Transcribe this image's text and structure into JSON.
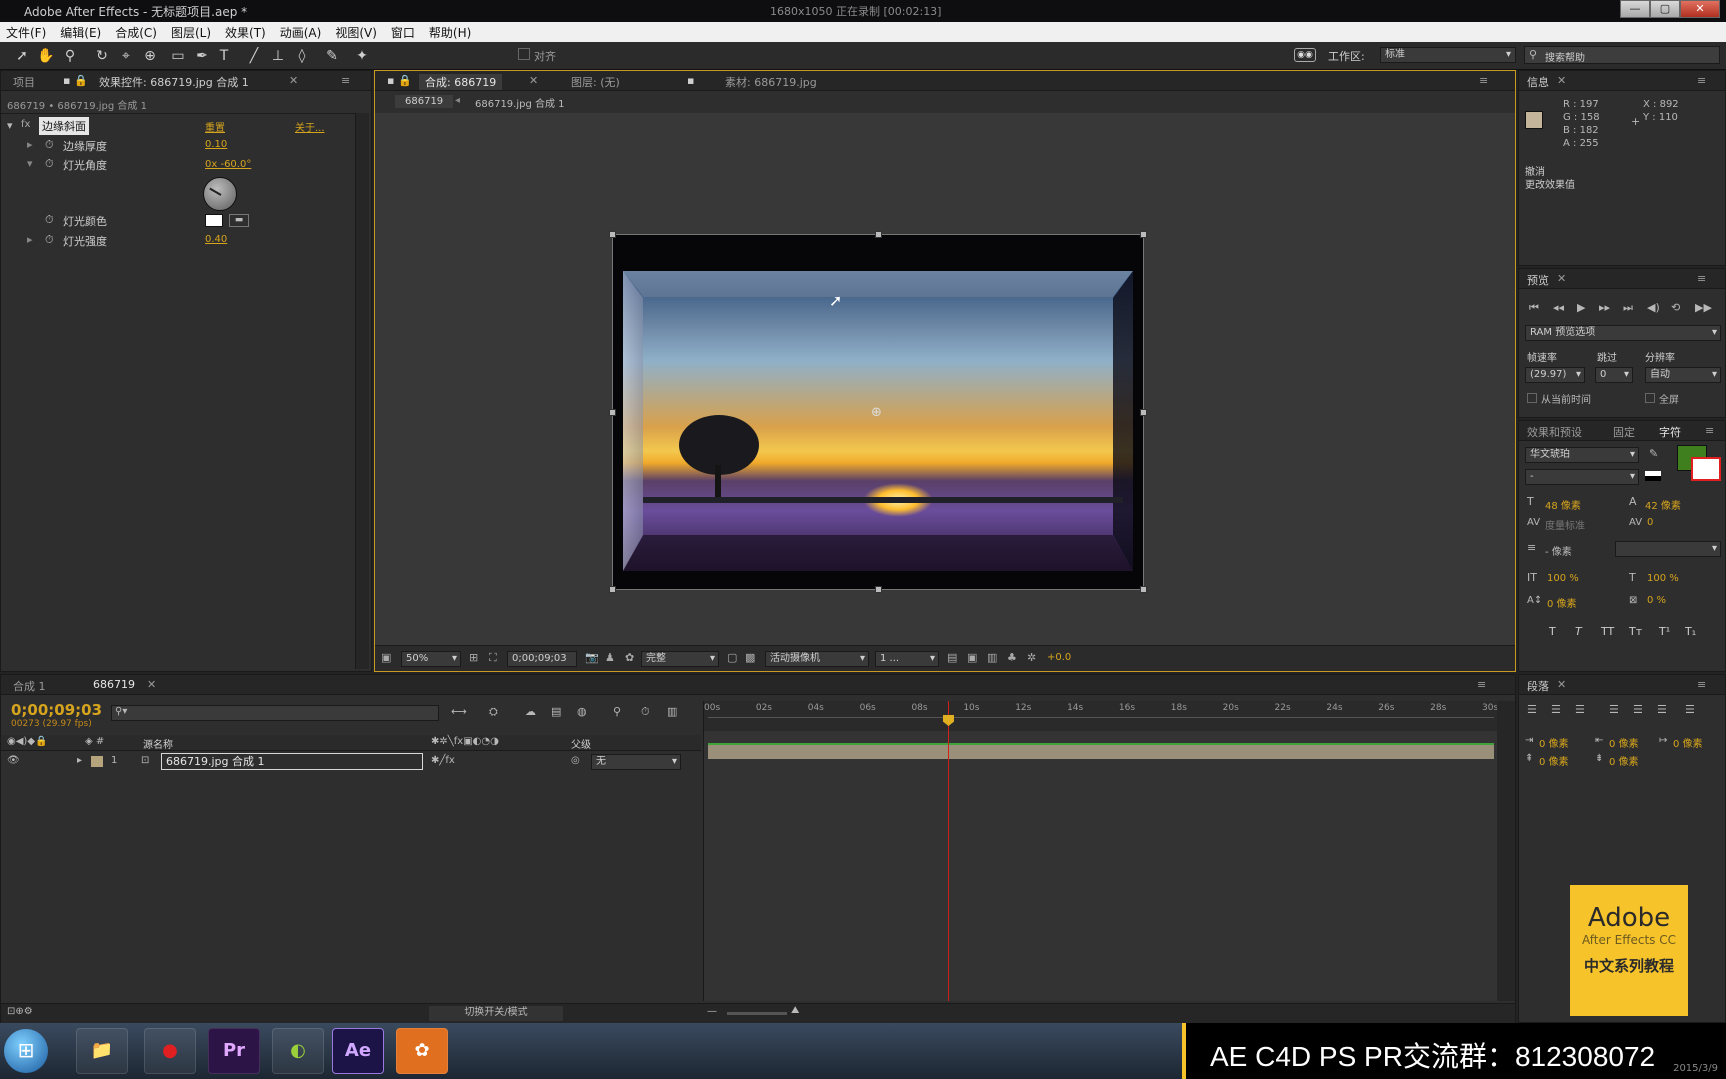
{
  "window": {
    "title": "Adobe After Effects - 无标题项目.aep *",
    "recording_info": "1680x1050  正在录制 [00:02:13]",
    "min_label": "—",
    "max_label": "▢",
    "close_label": "✕"
  },
  "menu": [
    "文件(F)",
    "编辑(E)",
    "合成(C)",
    "图层(L)",
    "效果(T)",
    "动画(A)",
    "视图(V)",
    "窗口",
    "帮助(H)"
  ],
  "toolbar": {
    "align_label": "对齐",
    "workspace_label": "工作区:",
    "workspace_value": "标准",
    "search_placeholder": "搜索帮助"
  },
  "effects_panel": {
    "tab_project": "项目",
    "tab_effects": "效果控件: 686719.jpg 合成 1",
    "breadcrumb": "686719 • 686719.jpg 合成 1",
    "effect_name": "边缘斜面",
    "reset": "重置",
    "about": "关于...",
    "params": [
      {
        "name": "边缘厚度",
        "value": "0.10"
      },
      {
        "name": "灯光角度",
        "value": "0x -60.0°"
      },
      {
        "name": "灯光颜色",
        "value": ""
      },
      {
        "name": "灯光强度",
        "value": "0.40"
      }
    ]
  },
  "comp_panel": {
    "tab_comp": "合成: 686719",
    "tab_layer": "图层: (无)",
    "tab_footage": "素材: 686719.jpg",
    "crumb1": "686719",
    "crumb2": "686719.jpg 合成 1",
    "zoom": "50%",
    "timecode": "0;00;09;03",
    "quality": "完整",
    "camera": "活动摄像机",
    "views": "1 ...",
    "exposure": "+0.0"
  },
  "info_panel": {
    "title": "信息",
    "r": "R : 197",
    "g": "G : 158",
    "b": "B : 182",
    "a": "A : 255",
    "x": "X : 892",
    "y": "Y : 110",
    "undo_line1": "撤消",
    "undo_line2": "更改效果值"
  },
  "preview_panel": {
    "title": "预览",
    "ram_options": "RAM 预览选项",
    "frame_rate_label": "帧速率",
    "skip_label": "跳过",
    "resolution_label": "分辨率",
    "frame_rate": "(29.97)",
    "skip": "0",
    "resolution": "自动",
    "from_current": "从当前时间",
    "fullscreen": "全屏"
  },
  "char_panel": {
    "tab_effects": "效果和预设",
    "tab_align": "固定",
    "tab_char": "字符",
    "font": "华文琥珀",
    "style": "-",
    "size": "48 像素",
    "leading": "42 像素",
    "tracking_label": "度量标准",
    "tracking": "0",
    "stroke": "- 像素",
    "vscale": "100 %",
    "hscale": "100 %",
    "baseline": "0 像素",
    "tsume": "0 %",
    "fill_color": "#3f7f1e"
  },
  "timeline": {
    "tab_render": "合成 1",
    "tab_comp": "686719",
    "timecode": "0;00;09;03",
    "fps": "00273 (29.97 fps)",
    "col_source": "源名称",
    "col_parent": "父级",
    "layer_index": "1",
    "layer_name": "686719.jpg 合成 1",
    "parent_value": "无",
    "toggle_label": "切换开关/模式",
    "ruler": [
      "00s",
      "02s",
      "04s",
      "06s",
      "08s",
      "10s",
      "12s",
      "14s",
      "16s",
      "18s",
      "20s",
      "22s",
      "24s",
      "26s",
      "28s",
      "30s"
    ],
    "playhead_seconds": 9.1
  },
  "paragraph_panel": {
    "title": "段落",
    "indent_left": "0 像素",
    "indent_right": "0 像素",
    "indent_first": "0 像素",
    "space_before": "0 像素",
    "space_after": "0 像素"
  },
  "overlay": {
    "logo_line1": "Adobe",
    "logo_line2": "After Effects CC",
    "logo_line3": "中文系列教程",
    "banner": "AE C4D PS PR交流群：812308072",
    "date": "2015/3/9"
  },
  "taskbar": {
    "start_label": "⊞",
    "apps": [
      "📁",
      "●",
      "Pr",
      "◐",
      "Ae",
      "✿"
    ]
  }
}
